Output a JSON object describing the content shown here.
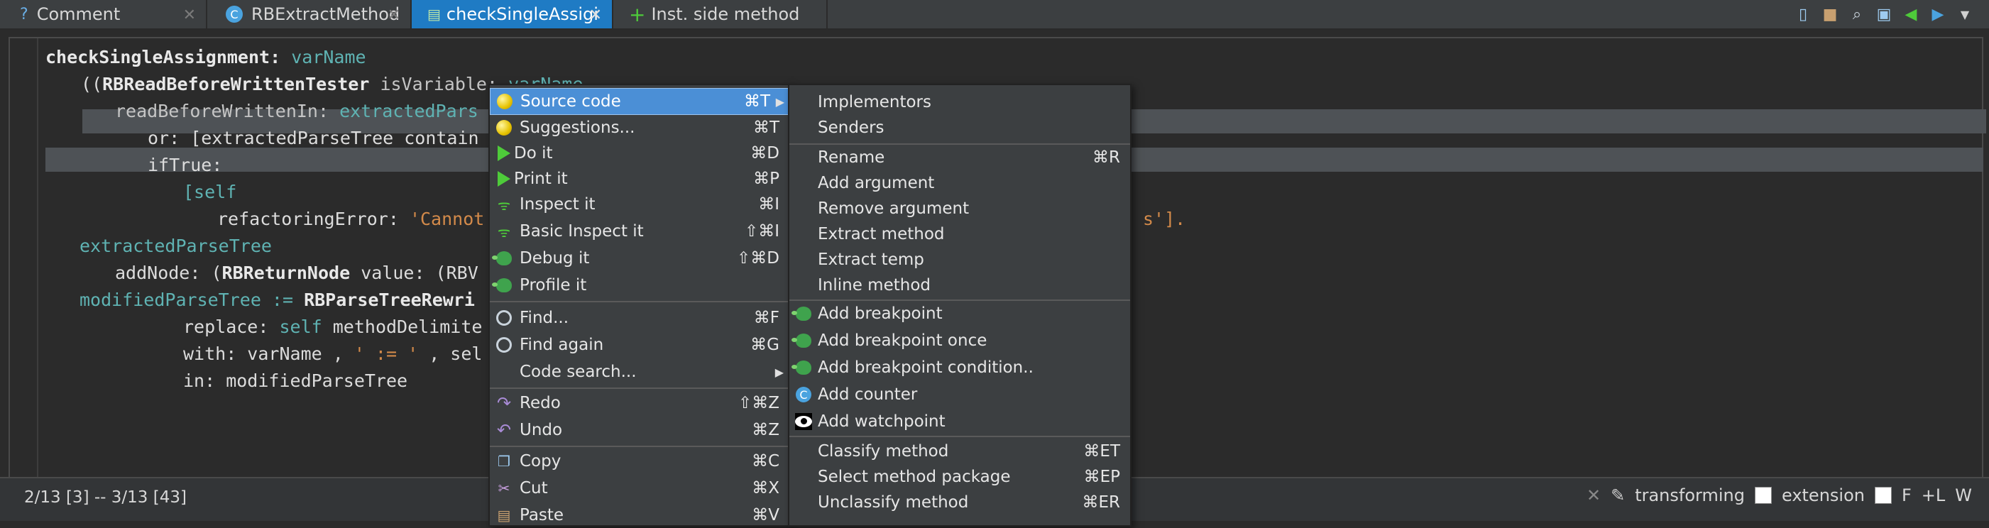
{
  "tabs": [
    {
      "label": "Comment",
      "icon": "?"
    },
    {
      "label": "RBExtractMethod",
      "icon": "C"
    },
    {
      "label": "checkSingleAssigi",
      "icon": "m"
    },
    {
      "label": "Inst. side method",
      "icon": "+"
    }
  ],
  "code": {
    "line1_sel": "checkSingleAssignment:",
    "line1_arg": " varName",
    "line2_open": "((",
    "line2_cls": "RBReadBeforeWrittenTester",
    "line2_msg": " isVariable:",
    "line2_arg": " varName",
    "line3_msg": "readBeforeWrittenIn:",
    "line3_arg": " extractedPars",
    "line4": "or: [extractedParseTree contain",
    "line5": "ifTrue:",
    "line6": "[self",
    "line7_msg": "refactoringError: ",
    "line7_str": "'Cannot",
    "line7_end": "s'].",
    "line8": "extractedParseTree",
    "line9_a": "addNode: (",
    "line9_cls": "RBReturnNode",
    "line9_b": " value: (RBV",
    "line10_a": "modifiedParseTree := ",
    "line10_cls": "RBParseTreeRewri",
    "line11_a": "replace: ",
    "line11_self": "self",
    "line11_b": " methodDelimite",
    "line12_a": "with: varName , ",
    "line12_str": "' := '",
    "line12_b": " , sel",
    "line13": "in: modifiedParseTree"
  },
  "status": {
    "position": "2/13 [3] -- 3/13 [43]",
    "transforming": "transforming",
    "extension": "extension",
    "f": "F",
    "l": "+L",
    "w": "W"
  },
  "menu1": [
    {
      "label": "Source code",
      "shortcut": "⌘T",
      "icon": "yellow-ball-icon",
      "submenu": true,
      "selected": true
    },
    {
      "label": "Suggestions...",
      "shortcut": "⌘T",
      "icon": "yellow-ball-icon"
    },
    {
      "label": "Do it",
      "shortcut": "⌘D",
      "icon": "play-icon"
    },
    {
      "label": "Print it",
      "shortcut": "⌘P",
      "icon": "play-icon"
    },
    {
      "label": "Inspect it",
      "shortcut": "⌘I",
      "icon": "cherries-icon"
    },
    {
      "label": "Basic Inspect it",
      "shortcut": "⇧⌘I",
      "icon": "cherries-icon"
    },
    {
      "label": "Debug it",
      "shortcut": "⇧⌘D",
      "icon": "bug-icon"
    },
    {
      "label": "Profile it",
      "shortcut": "",
      "icon": "bug-icon"
    },
    {
      "label": "Find...",
      "shortcut": "⌘F",
      "icon": "magnifier-icon"
    },
    {
      "label": "Find again",
      "shortcut": "⌘G",
      "icon": "magnifier-icon"
    },
    {
      "label": "Code search...",
      "shortcut": "",
      "icon": "",
      "submenu": true
    },
    {
      "label": "Redo",
      "shortcut": "⇧⌘Z",
      "icon": "redo-icon"
    },
    {
      "label": "Undo",
      "shortcut": "⌘Z",
      "icon": "undo-icon"
    },
    {
      "label": "Copy",
      "shortcut": "⌘C",
      "icon": "copy-icon"
    },
    {
      "label": "Cut",
      "shortcut": "⌘X",
      "icon": "scissors-icon"
    },
    {
      "label": "Paste",
      "shortcut": "⌘V",
      "icon": "paste-icon"
    }
  ],
  "menu2": [
    {
      "label": "Implementors",
      "shortcut": ""
    },
    {
      "label": "Senders",
      "shortcut": ""
    },
    {
      "label": "Rename",
      "shortcut": "⌘R"
    },
    {
      "label": "Add argument",
      "shortcut": ""
    },
    {
      "label": "Remove argument",
      "shortcut": ""
    },
    {
      "label": "Extract method",
      "shortcut": ""
    },
    {
      "label": "Extract temp",
      "shortcut": ""
    },
    {
      "label": "Inline method",
      "shortcut": ""
    },
    {
      "label": "Add breakpoint",
      "shortcut": "",
      "icon": "bug-icon"
    },
    {
      "label": "Add breakpoint once",
      "shortcut": "",
      "icon": "bug-icon"
    },
    {
      "label": "Add breakpoint condition..",
      "shortcut": "",
      "icon": "bug-icon"
    },
    {
      "label": "Add counter",
      "shortcut": "",
      "icon": "counter-icon"
    },
    {
      "label": "Add watchpoint",
      "shortcut": "",
      "icon": "eye-icon"
    },
    {
      "label": "Classify method",
      "shortcut": "⌘ET"
    },
    {
      "label": "Select method package",
      "shortcut": "⌘EP"
    },
    {
      "label": "Unclassify method",
      "shortcut": "⌘ER"
    }
  ],
  "colors": {
    "accent": "#1f7bc4",
    "selection": "#4b8fd6",
    "background": "#2b2b2b",
    "menu": "#3c3f41"
  }
}
